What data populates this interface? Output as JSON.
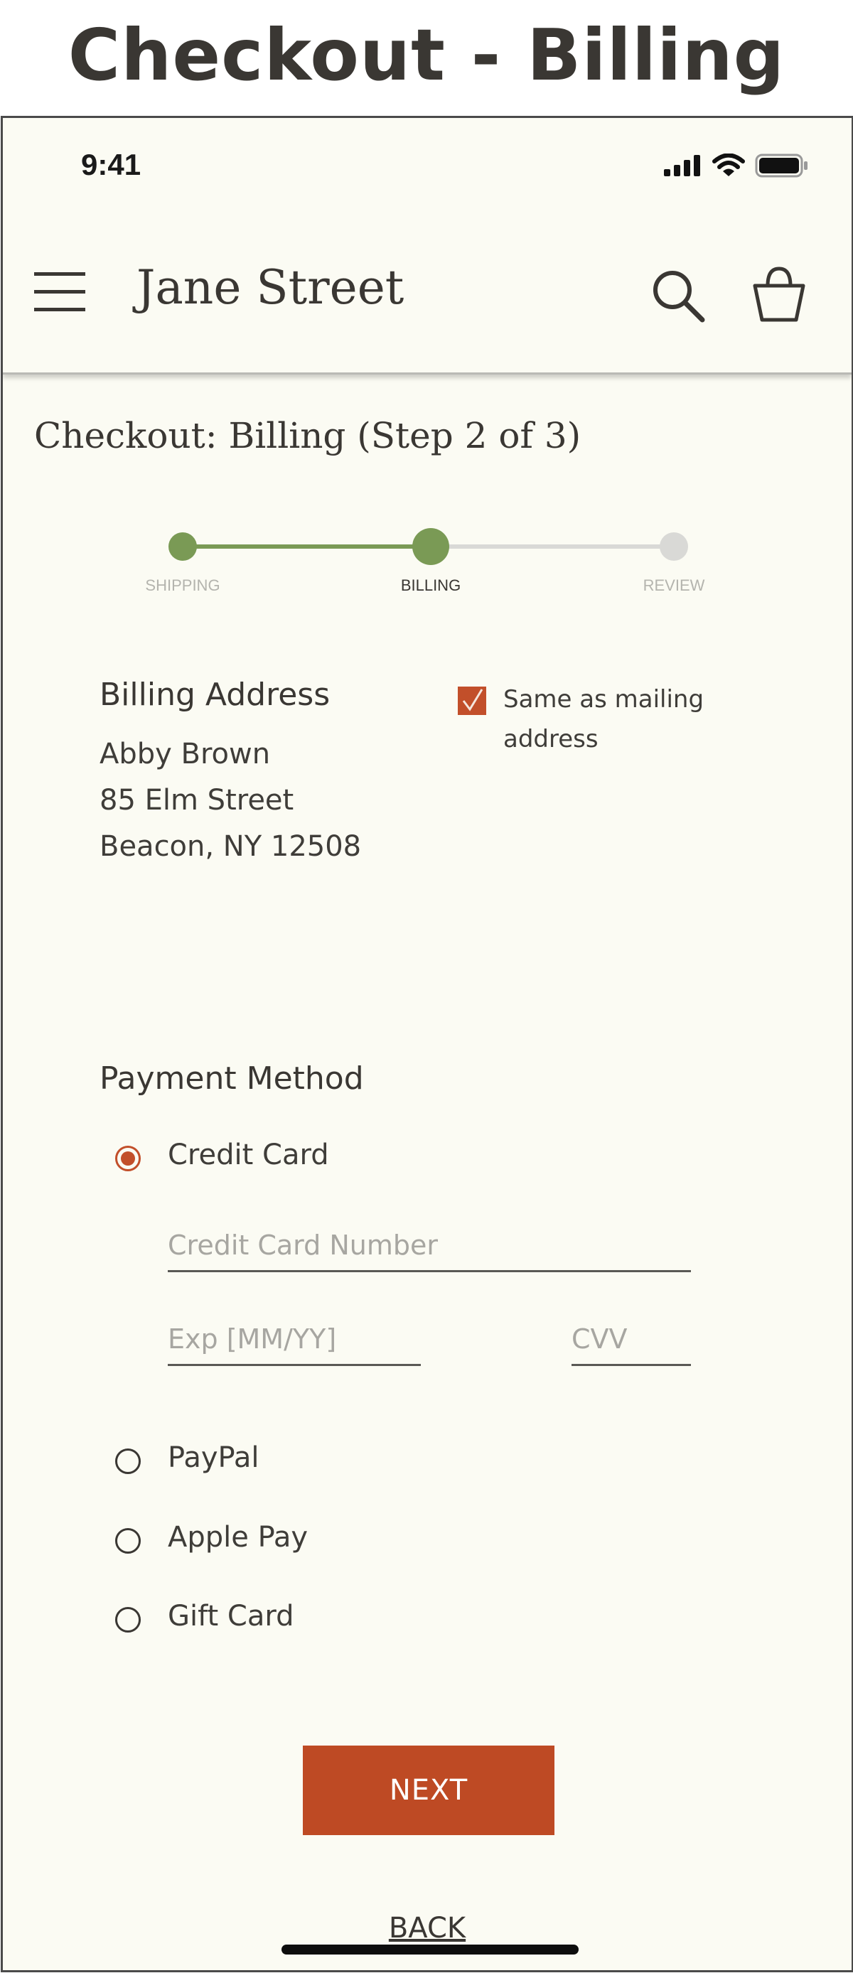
{
  "page_title": "Checkout - Billing",
  "status_bar": {
    "time": "9:41",
    "icons": [
      "signal-icon",
      "wifi-icon",
      "battery-icon"
    ]
  },
  "header": {
    "brand": "Jane Street",
    "icons": [
      "menu-icon",
      "search-icon",
      "shopping-bag-icon"
    ]
  },
  "checkout": {
    "heading": "Checkout: Billing (Step 2 of 3)",
    "steps": [
      {
        "label": "SHIPPING",
        "state": "complete"
      },
      {
        "label": "BILLING",
        "state": "current"
      },
      {
        "label": "REVIEW",
        "state": "upcoming"
      }
    ]
  },
  "billing_address": {
    "title": "Billing Address",
    "lines": [
      "Abby Brown",
      "85 Elm Street",
      "Beacon, NY 12508"
    ],
    "same_as_mailing_label": "Same as mailing address",
    "same_as_mailing_checked": true
  },
  "payment": {
    "title": "Payment Method",
    "options": [
      {
        "label": "Credit Card",
        "selected": true
      },
      {
        "label": "PayPal",
        "selected": false
      },
      {
        "label": "Apple Pay",
        "selected": false
      },
      {
        "label": "Gift Card",
        "selected": false
      }
    ],
    "card_number": {
      "value": "",
      "placeholder": "Credit Card Number"
    },
    "expiry": {
      "value": "",
      "placeholder": "Exp [MM/YY]"
    },
    "cvv": {
      "value": "",
      "placeholder": "CVV"
    }
  },
  "actions": {
    "next_label": "NEXT",
    "back_label": "BACK"
  },
  "colors": {
    "accent": "#be4a24",
    "step_active": "#7a9a55",
    "step_inactive": "#d9d9d6",
    "background": "#fbfbf3"
  }
}
